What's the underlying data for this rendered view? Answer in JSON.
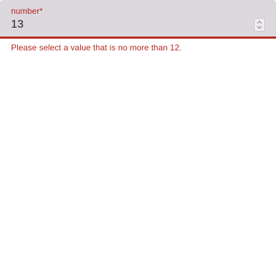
{
  "field": {
    "label": "number*",
    "value": "13",
    "error_text": "Please select a value that is no more than 12."
  },
  "icons": {
    "stepper_up": "chevron-up-icon",
    "stepper_down": "chevron-down-icon"
  },
  "colors": {
    "error": "#b3261e",
    "field_background": "#dcd8de",
    "text": "#1d1b20"
  }
}
